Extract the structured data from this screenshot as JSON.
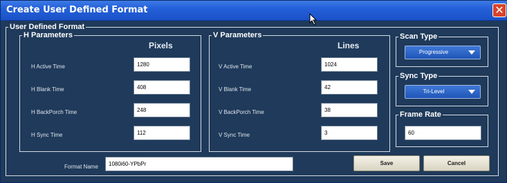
{
  "window": {
    "title": "Create User Defined Format",
    "close_glyph": "✕"
  },
  "outer_group": {
    "legend": "User Defined Format"
  },
  "h_params": {
    "legend": "H Parameters",
    "column_header": "Pixels",
    "rows": [
      {
        "label": "H Active Time",
        "value": "1280"
      },
      {
        "label": "H Blank Time",
        "value": "408"
      },
      {
        "label": "H BackPorch Time",
        "value": "248"
      },
      {
        "label": "H Sync Time",
        "value": "112"
      }
    ]
  },
  "v_params": {
    "legend": "V Parameters",
    "column_header": "Lines",
    "rows": [
      {
        "label": "V Active Time",
        "value": "1024"
      },
      {
        "label": "V Blank Time",
        "value": "42"
      },
      {
        "label": "V BackPorch Time",
        "value": "38"
      },
      {
        "label": "V Sync Time",
        "value": "3"
      }
    ]
  },
  "scan_type": {
    "legend": "Scan Type",
    "selected": "Progressive"
  },
  "sync_type": {
    "legend": "Sync Type",
    "selected": "Tri-Level"
  },
  "frame_rate": {
    "legend": "Frame Rate",
    "value": "60"
  },
  "format_name": {
    "label": "Format Name",
    "value": "1080i60-YPbPr"
  },
  "buttons": {
    "save": "Save",
    "cancel": "Cancel"
  },
  "colors": {
    "dialog_background": "#1f3a5a",
    "title_bar": "#2460d8",
    "close_button": "#d9442b",
    "dropdown": "#2a62c8",
    "group_border": "#d6dde6"
  },
  "icons": {
    "cursor": "mouse-pointer-icon",
    "close": "close-icon",
    "dropdown": "chevron-down-icon"
  }
}
